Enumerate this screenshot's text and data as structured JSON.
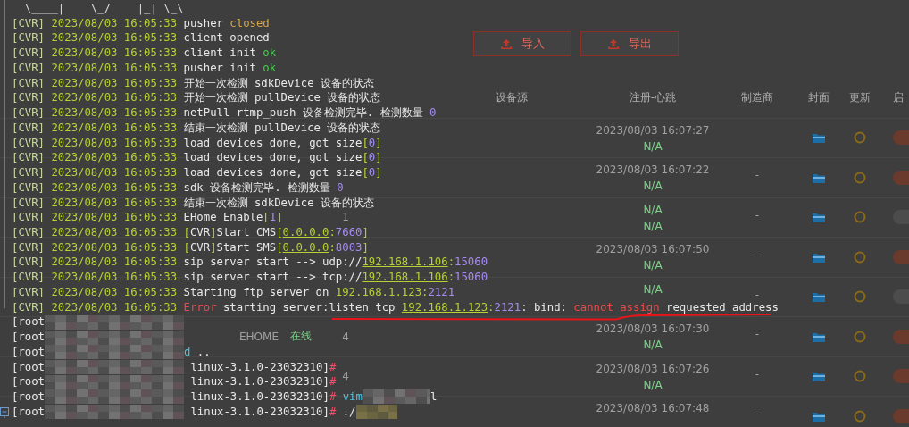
{
  "page": {
    "buttons": [
      {
        "label": "导入"
      },
      {
        "label": "导出"
      }
    ],
    "table": {
      "header": {
        "source": "设备源",
        "registered": "注册-心跳",
        "maker": "制造商",
        "cover": "封面",
        "update": "更新",
        "enable": "启"
      },
      "rows": [
        {
          "registered": "2023/08/03 16:07:27",
          "heartbeat": "N/A",
          "enabled": true
        },
        {
          "registered": "2023/08/03 16:07:22",
          "heartbeat": "N/A",
          "maker": "-",
          "enabled": true
        },
        {
          "count": "1",
          "registered": "N/A",
          "heartbeat": "N/A",
          "maker": "-",
          "enabled": false
        },
        {
          "registered": "2023/08/03 16:07:50",
          "heartbeat": "N/A",
          "maker": "-",
          "enabled": true
        },
        {
          "registered": "N/A",
          "maker": "-",
          "enabled": false
        },
        {
          "type": "EHOME",
          "status": "在线",
          "count": "4",
          "registered": "2023/08/03 16:07:30",
          "heartbeat": "N/A",
          "maker": "-",
          "enabled": true
        },
        {
          "count": "4",
          "registered": "2023/08/03 16:07:26",
          "heartbeat": "N/A",
          "maker": "-",
          "enabled": true
        },
        {
          "registered": "2023/08/03 16:07:48",
          "maker": "-",
          "enabled": true
        }
      ]
    }
  },
  "terminal": {
    "banner": "  \\____|    \\_/    |_| \\_\\",
    "log": [
      {
        "tag": "[CVR]",
        "time": "2023/08/03 16:05:33",
        "parts": [
          {
            "text": "pusher ",
            "kind": "plain"
          },
          {
            "text": "closed",
            "kind": "warn"
          }
        ]
      },
      {
        "tag": "[CVR]",
        "time": "2023/08/03 16:05:33",
        "parts": [
          {
            "text": "client opened",
            "kind": "plain"
          }
        ]
      },
      {
        "tag": "[CVR]",
        "time": "2023/08/03 16:05:33",
        "parts": [
          {
            "text": "client init ",
            "kind": "plain"
          },
          {
            "text": "ok",
            "kind": "ok"
          }
        ]
      },
      {
        "tag": "[CVR]",
        "time": "2023/08/03 16:05:33",
        "parts": [
          {
            "text": "pusher init ",
            "kind": "plain"
          },
          {
            "text": "ok",
            "kind": "ok"
          }
        ]
      },
      {
        "tag": "[CVR]",
        "time": "2023/08/03 16:05:33",
        "parts": [
          {
            "text": "开始一次检测 sdkDevice 设备的状态",
            "kind": "plain"
          }
        ]
      },
      {
        "tag": "[CVR]",
        "time": "2023/08/03 16:05:33",
        "parts": [
          {
            "text": "开始一次检测 pullDevice 设备的状态",
            "kind": "plain"
          }
        ]
      },
      {
        "tag": "[CVR]",
        "time": "2023/08/03 16:05:33",
        "parts": [
          {
            "text": "netPull rtmp_push 设备检测完毕. 检测数量 ",
            "kind": "plain"
          },
          {
            "text": "0",
            "kind": "num"
          }
        ]
      },
      {
        "tag": "[CVR]",
        "time": "2023/08/03 16:05:33",
        "parts": [
          {
            "text": "结束一次检测 pullDevice 设备的状态",
            "kind": "plain"
          }
        ]
      },
      {
        "tag": "[CVR]",
        "time": "2023/08/03 16:05:33",
        "parts": [
          {
            "text": "load devices done, got size",
            "kind": "plain"
          },
          {
            "text": "[",
            "kind": "br"
          },
          {
            "text": "0",
            "kind": "num"
          },
          {
            "text": "]",
            "kind": "br"
          }
        ]
      },
      {
        "tag": "[CVR]",
        "time": "2023/08/03 16:05:33",
        "parts": [
          {
            "text": "load devices done, got size",
            "kind": "plain"
          },
          {
            "text": "[",
            "kind": "br"
          },
          {
            "text": "0",
            "kind": "num"
          },
          {
            "text": "]",
            "kind": "br"
          }
        ]
      },
      {
        "tag": "[CVR]",
        "time": "2023/08/03 16:05:33",
        "parts": [
          {
            "text": "load devices done, got size",
            "kind": "plain"
          },
          {
            "text": "[",
            "kind": "br"
          },
          {
            "text": "0",
            "kind": "num"
          },
          {
            "text": "]",
            "kind": "br"
          }
        ]
      },
      {
        "tag": "[CVR]",
        "time": "2023/08/03 16:05:33",
        "parts": [
          {
            "text": "sdk 设备检测完毕. 检测数量 ",
            "kind": "plain"
          },
          {
            "text": "0",
            "kind": "num"
          }
        ]
      },
      {
        "tag": "[CVR]",
        "time": "2023/08/03 16:05:33",
        "parts": [
          {
            "text": "结束一次检测 sdkDevice 设备的状态",
            "kind": "plain"
          }
        ]
      },
      {
        "tag": "[CVR]",
        "time": "2023/08/03 16:05:33",
        "parts": [
          {
            "text": "EHome Enable",
            "kind": "plain"
          },
          {
            "text": "[",
            "kind": "br"
          },
          {
            "text": "1",
            "kind": "num"
          },
          {
            "text": "]",
            "kind": "br"
          }
        ]
      },
      {
        "tag": "[CVR]",
        "time": "2023/08/03 16:05:33",
        "parts": [
          {
            "text": "[",
            "kind": "br"
          },
          {
            "text": "CVR",
            "kind": "plain"
          },
          {
            "text": "]",
            "kind": "br"
          },
          {
            "text": "Start CMS",
            "kind": "plain"
          },
          {
            "text": "[",
            "kind": "br"
          },
          {
            "text": "0.0.0.0",
            "kind": "ip"
          },
          {
            "text": ":",
            "kind": "br"
          },
          {
            "text": "7660",
            "kind": "num"
          },
          {
            "text": "]",
            "kind": "br"
          }
        ]
      },
      {
        "tag": "[CVR]",
        "time": "2023/08/03 16:05:33",
        "parts": [
          {
            "text": "[",
            "kind": "br"
          },
          {
            "text": "CVR",
            "kind": "plain"
          },
          {
            "text": "]",
            "kind": "br"
          },
          {
            "text": "Start SMS",
            "kind": "plain"
          },
          {
            "text": "[",
            "kind": "br"
          },
          {
            "text": "0.0.0.0",
            "kind": "ip"
          },
          {
            "text": ":",
            "kind": "br"
          },
          {
            "text": "8003",
            "kind": "num"
          },
          {
            "text": "]",
            "kind": "br"
          }
        ]
      },
      {
        "tag": "[CVR]",
        "time": "2023/08/03 16:05:33",
        "parts": [
          {
            "text": "sip server start --> udp://",
            "kind": "plain"
          },
          {
            "text": "192.168.1.106",
            "kind": "ip"
          },
          {
            "text": ":",
            "kind": "br"
          },
          {
            "text": "15060",
            "kind": "num"
          }
        ]
      },
      {
        "tag": "[CVR]",
        "time": "2023/08/03 16:05:33",
        "parts": [
          {
            "text": "sip server start --> tcp://",
            "kind": "plain"
          },
          {
            "text": "192.168.1.106",
            "kind": "ip"
          },
          {
            "text": ":",
            "kind": "br"
          },
          {
            "text": "15060",
            "kind": "num"
          }
        ]
      },
      {
        "tag": "[CVR]",
        "time": "2023/08/03 16:05:33",
        "parts": [
          {
            "text": "Starting ftp server on ",
            "kind": "plain"
          },
          {
            "text": "192.168.1.123",
            "kind": "ip"
          },
          {
            "text": ":",
            "kind": "br"
          },
          {
            "text": "2121",
            "kind": "num"
          }
        ]
      },
      {
        "tag": "[CVR]",
        "time": "2023/08/03 16:05:33",
        "parts": [
          {
            "text": "Error",
            "kind": "err"
          },
          {
            "text": " starting server:listen tcp ",
            "kind": "plain"
          },
          {
            "text": "192.168.1.123",
            "kind": "ip"
          },
          {
            "text": ":",
            "kind": "br"
          },
          {
            "text": "2121",
            "kind": "num"
          },
          {
            "text": ": bind: ",
            "kind": "plain"
          },
          {
            "text": "cannot assign",
            "kind": "err"
          },
          {
            "text": " requested address",
            "kind": "plain"
          }
        ]
      }
    ],
    "shell": [
      {
        "parts": [
          {
            "text": "[root",
            "kind": "plain"
          },
          {
            "kind": "redacted"
          }
        ]
      },
      {
        "parts": [
          {
            "text": "[root",
            "kind": "plain"
          },
          {
            "kind": "redacted"
          }
        ]
      },
      {
        "parts": [
          {
            "text": "[root",
            "kind": "plain"
          },
          {
            "kind": "redacted"
          },
          {
            "text": "d",
            "kind": "cmd"
          },
          {
            "text": " ..",
            "kind": "plain"
          }
        ]
      },
      {
        "parts": [
          {
            "text": "[root",
            "kind": "plain"
          },
          {
            "kind": "redacted"
          },
          {
            "text": " linux-3.1.0-23032310]",
            "kind": "plain"
          },
          {
            "text": "#",
            "kind": "hash"
          }
        ]
      },
      {
        "parts": [
          {
            "text": "[root",
            "kind": "plain"
          },
          {
            "kind": "redacted"
          },
          {
            "text": " linux-3.1.0-23032310]",
            "kind": "plain"
          },
          {
            "text": "#",
            "kind": "hash"
          }
        ]
      },
      {
        "parts": [
          {
            "text": "[root",
            "kind": "plain"
          },
          {
            "kind": "redacted"
          },
          {
            "text": " linux-3.1.0-23032310]",
            "kind": "plain"
          },
          {
            "text": "#",
            "kind": "hash"
          },
          {
            "text": " vim",
            "kind": "cmd"
          },
          {
            "kind": "redacted_arg"
          },
          {
            "text": "l",
            "kind": "plain"
          }
        ]
      },
      {
        "parts": [
          {
            "text": "[root",
            "kind": "plain"
          },
          {
            "kind": "redacted"
          },
          {
            "text": " linux-3.1.0-23032310]",
            "kind": "plain"
          },
          {
            "text": "#",
            "kind": "hash"
          },
          {
            "text": " ./",
            "kind": "plain"
          },
          {
            "kind": "redacted_cmd"
          }
        ]
      }
    ]
  }
}
